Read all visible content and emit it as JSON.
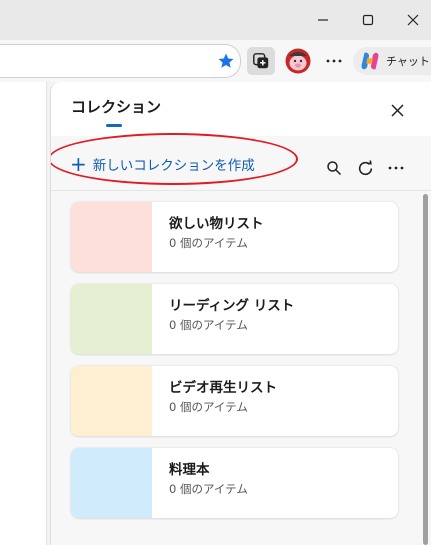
{
  "browser": {
    "window_controls": {
      "minimize": "minimize-icon",
      "maximize": "maximize-icon",
      "close": "close-icon"
    },
    "toolbar": {
      "icons": [
        "favorite-star-icon",
        "collections-icon",
        "profile-avatar-icon",
        "more-icon",
        "copilot-icon"
      ],
      "copilot_label": "チャット"
    }
  },
  "panel": {
    "title": "コレクション",
    "close_icon": "close-icon",
    "new_collection_label": "新しいコレクションを作成",
    "action_icons": [
      "search-icon",
      "refresh-icon",
      "more-icon"
    ],
    "collections": [
      {
        "title": "欲しい物リスト",
        "count": "0 個のアイテム",
        "color": "#fde0d9"
      },
      {
        "title": "リーディング リスト",
        "count": "0 個のアイテム",
        "color": "#e5f0d2"
      },
      {
        "title": "ビデオ再生リスト",
        "count": "0 個のアイテム",
        "color": "#fdefd0"
      },
      {
        "title": "料理本",
        "count": "0 個のアイテム",
        "color": "#cfebfc"
      }
    ]
  },
  "colors": {
    "accent": "#0f6cbd",
    "annotation": "#e01b24"
  }
}
